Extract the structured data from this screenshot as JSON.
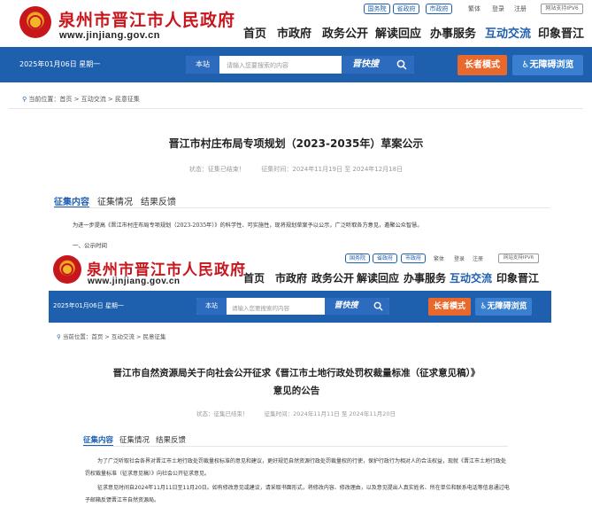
{
  "top_frame": {
    "site": {
      "title": "泉州市晋江市人民政府",
      "url": "www.jinjiang.gov.cn"
    },
    "top_links": [
      "国务院",
      "省政府",
      "市政府"
    ],
    "util_links": [
      "繁体",
      "登录",
      "注册"
    ],
    "ipv6": "网站支持IPV6",
    "nav": [
      "首页",
      "市政府",
      "政务公开",
      "解读回应",
      "办事服务",
      "互动交流",
      "印象晋江"
    ],
    "active_nav": "互动交流",
    "bar": {
      "date": "2025年01月06日   星期一",
      "search_scope": "本站",
      "search_placeholder": "请输入您要搜索的内容",
      "search_brand": "晋快搜",
      "elder_mode": "长者模式",
      "accessible": "无障碍浏览"
    },
    "breadcrumb": "当前位置：首页 > 互动交流 > 民意征集",
    "article": {
      "title": "晋江市村庄布局专项规划（2023-2035年）草案公示",
      "status": "状态：征集已结束！",
      "period": "征集时间：2024年11月19日 至 2024年12月18日"
    },
    "tabs": [
      "征集内容",
      "征集情况",
      "结果反馈"
    ],
    "active_tab": "征集内容",
    "body_line": "为进一步提高《晋江市村庄布局专项规划（2023-2035年）》的科学性、可实施性，现将规划草案予以公示，广泛听取各方意见，邀聚公众智慧。",
    "section_heading": "一、公示时间"
  },
  "bottom_frame": {
    "site": {
      "title": "泉州市晋江市人民政府",
      "url": "www.jinjiang.gov.cn"
    },
    "top_links": [
      "国务院",
      "省政府",
      "市政府"
    ],
    "util_links": [
      "繁体",
      "登录",
      "注册"
    ],
    "ipv6": "网站支持IPV6",
    "nav": [
      "首页",
      "市政府",
      "政务公开",
      "解读回应",
      "办事服务",
      "互动交流",
      "印象晋江"
    ],
    "active_nav": "互动交流",
    "bar": {
      "date": "2025年01月06日   星期一",
      "search_scope": "本站",
      "search_placeholder": "请输入您要搜索的内容",
      "search_brand": "晋快搜",
      "elder_mode": "长者模式",
      "accessible": "无障碍浏览"
    },
    "breadcrumb": "当前位置：首页 > 互动交流 > 民意征集",
    "article": {
      "title_line1": "晋江市自然资源局关于向社会公开征求《晋江市土地行政处罚权裁量标准（征求意见稿）》",
      "title_line2": "意见的公告",
      "status": "状态：征集已结束！",
      "period": "征集时间：2024年11月11日 至 2024年11月20日"
    },
    "tabs": [
      "征集内容",
      "征集情况",
      "结果反馈"
    ],
    "active_tab": "征集内容",
    "para1": "为了广泛听取社会各界对晋江市土地行政处罚裁量权标准的意见和建议，更好规范自然资源行政处罚裁量权的行使，保护行政行为相对人的合法权益，现就《晋江市土地行政处罚权裁量标准（征求意见稿）》向社会公开征求意见。",
    "para2": "征求意见时间自2024年11月11日至11月20日。如有修改意见或建议，请采取书面形式，将修改内容、修改理由，以及意见提出人真实姓名、所在单位和联系电话等信息通过电子邮箱反馈晋江市自然资源局。"
  },
  "colors": {
    "brand_red": "#c8161d",
    "brand_blue": "#1e5fae",
    "accent_orange": "#e8692b"
  }
}
